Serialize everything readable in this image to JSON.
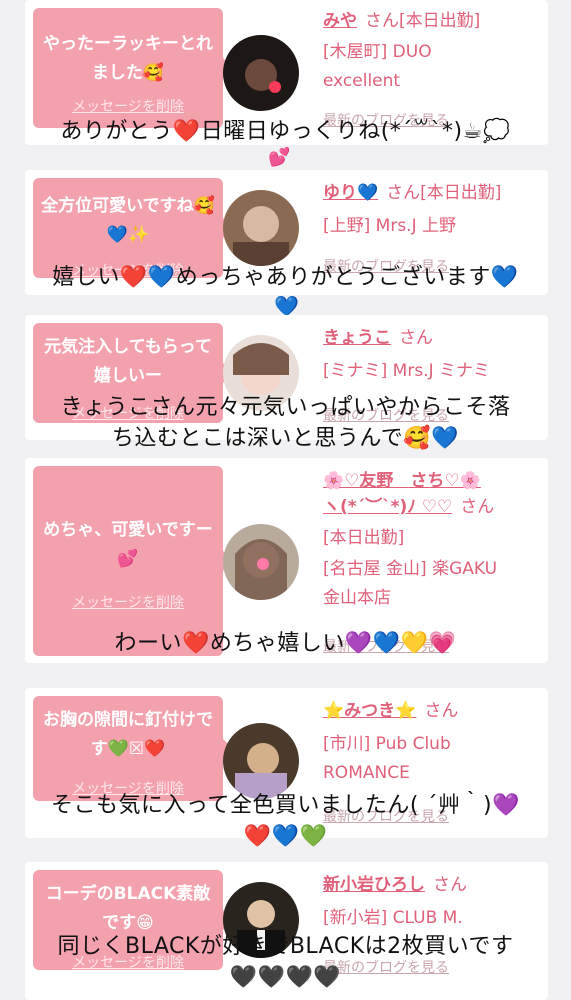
{
  "cards": [
    {
      "bubble": {
        "message": "やったーラッキーとれました🥰",
        "delete_link": "メッセージを削除"
      },
      "name": "みや",
      "san": "さん",
      "status": "[本日出勤]",
      "location_line1": "[木屋町] DUO",
      "location_line2": "excellent",
      "blog_link": "最新のブログを見る",
      "avatar_icon": "photo-avatar-dark"
    },
    {
      "bubble": {
        "message": "全方位可愛いですね🥰💙✨",
        "delete_link": "メッセージを削除"
      },
      "name": "ゆり💙",
      "san": "さん",
      "status": "[本日出勤]",
      "location_line1": "[上野] Mrs.J 上野",
      "blog_link": "最新のブログを見る",
      "avatar_icon": "photo-avatar-brown"
    },
    {
      "bubble": {
        "message": "元気注入してもらって嬉しいー",
        "delete_link": "メッセージを削除"
      },
      "name": "きょうこ",
      "san": "さん",
      "location_line1": "[ミナミ] Mrs.J ミナミ",
      "blog_link": "最新のブログを見る",
      "avatar_icon": "photo-avatar-light"
    },
    {
      "bubble": {
        "message": "めちゃ、可愛いですー💕",
        "delete_link": "メッセージを削除"
      },
      "name": "🌸♡友野　さち♡🌸",
      "name2": "ヽ(*´︶`*)ﾉ ♡♡",
      "san": "さん",
      "status": "[本日出勤]",
      "location_line1": "[名古屋 金山] 楽GAKU",
      "location_line2": "金山本店",
      "blog_link": "最新のブログを見る",
      "avatar_icon": "photo-avatar-mixed"
    },
    {
      "bubble": {
        "message": "お胸の隙間に釘付けです💚☒❤️",
        "delete_link": "メッセージを削除"
      },
      "name": "⭐みつき⭐",
      "san": "さん",
      "location_line1": "[市川] Pub Club",
      "location_line2": "ROMANCE",
      "blog_link": "最新のブログを見る",
      "avatar_icon": "photo-avatar-warm"
    },
    {
      "bubble": {
        "message": "コーデのBLACK素敵です😁",
        "delete_link": "メッセージを削除"
      },
      "name": "新小岩ひろし",
      "san": "さん",
      "location_line1": "[新小岩] CLUB M.",
      "blog_link": "最新のブログを見る",
      "avatar_icon": "photo-avatar-man"
    }
  ],
  "comments": [
    {
      "line1": "ありがとう❤️日曜日ゆっくりね(*ˊ꒳ˋ*)☕💭",
      "line2": "💕"
    },
    {
      "line1": "嬉しい❤️💙めっちゃありがとうございます💙",
      "line2": "💙"
    },
    {
      "line1": "きょうこさん元々元気いっぱいやからこそ落",
      "line2": "ち込むとこは深いと思うんで🥰💙"
    },
    {
      "line1": "わーい❤️めちゃ嬉しい💜💙💛💗"
    },
    {
      "line1": "そこも気に入って全色買いましたん( ´艸｀)💜",
      "line2": "❤️💙💚"
    },
    {
      "line1": "同じくBLACKが好きでBLACKは2枚買いです",
      "line2": "🖤🖤🖤🖤"
    }
  ],
  "colors": {
    "bubble": "#f4a1ae",
    "accent": "#e0607a",
    "background": "#f1f1f3"
  }
}
